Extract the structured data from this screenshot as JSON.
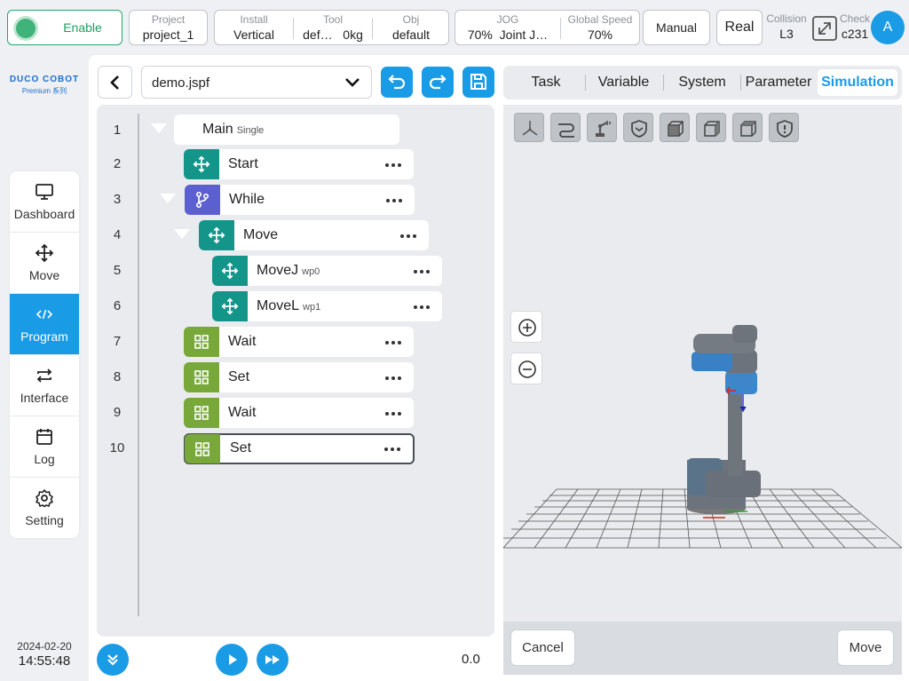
{
  "status": {
    "enable_label": "Enable",
    "project": {
      "caption": "Project",
      "value": "project_1"
    },
    "install": {
      "caption": "Install",
      "value": "Vertical"
    },
    "tool": {
      "caption": "Tool",
      "name": "def…",
      "weight": "0kg"
    },
    "obj": {
      "caption": "Obj",
      "value": "default"
    },
    "jog": {
      "caption": "JOG",
      "value": "70%",
      "mode": "Joint J…"
    },
    "global_speed": {
      "caption": "Global Speed",
      "value": "70%"
    },
    "mode": "Manual",
    "run_mode": "Real",
    "collision": {
      "caption": "Collision",
      "value": "L3"
    },
    "check": {
      "caption": "Check",
      "value": "c231"
    },
    "avatar": "A"
  },
  "brand": {
    "name": "DUCO COBOT",
    "series": "Premium 系列"
  },
  "nav": [
    {
      "id": "dashboard",
      "label": "Dashboard",
      "icon": "monitor-icon",
      "active": false
    },
    {
      "id": "move",
      "label": "Move",
      "icon": "move-arrows-icon",
      "active": false
    },
    {
      "id": "program",
      "label": "Program",
      "icon": "code-icon",
      "active": true
    },
    {
      "id": "interface",
      "label": "Interface",
      "icon": "swap-icon",
      "active": false
    },
    {
      "id": "log",
      "label": "Log",
      "icon": "calendar-icon",
      "active": false
    },
    {
      "id": "setting",
      "label": "Setting",
      "icon": "gear-icon",
      "active": false
    }
  ],
  "datetime": {
    "date": "2024-02-20",
    "time": "14:55:48"
  },
  "program": {
    "file": "demo.jspf",
    "nodes": [
      {
        "line": "1",
        "title": "Main",
        "sub": "Single",
        "type": "main"
      },
      {
        "line": "2",
        "title": "Start",
        "sub": "",
        "type": "move"
      },
      {
        "line": "3",
        "title": "While",
        "sub": "",
        "type": "while"
      },
      {
        "line": "4",
        "title": "Move",
        "sub": "",
        "type": "move"
      },
      {
        "line": "5",
        "title": "MoveJ",
        "sub": "wp0",
        "type": "move"
      },
      {
        "line": "6",
        "title": "MoveL",
        "sub": "wp1",
        "type": "move"
      },
      {
        "line": "7",
        "title": "Wait",
        "sub": "",
        "type": "logic"
      },
      {
        "line": "8",
        "title": "Set",
        "sub": "",
        "type": "logic"
      },
      {
        "line": "9",
        "title": "Wait",
        "sub": "",
        "type": "logic"
      },
      {
        "line": "10",
        "title": "Set",
        "sub": "",
        "type": "logic",
        "selected": true
      }
    ],
    "speed_readout": "0.0"
  },
  "tabs": [
    {
      "label": "Task",
      "active": false
    },
    {
      "label": "Variable",
      "active": false
    },
    {
      "label": "System",
      "active": false
    },
    {
      "label": "Parameter",
      "active": false
    },
    {
      "label": "Simulation",
      "active": true
    }
  ],
  "simulation": {
    "view_buttons": [
      "axes-view-icon",
      "path-icon",
      "robot-view-icon",
      "shield-icon",
      "cube-front-icon",
      "cube-side-icon",
      "cube-top-icon",
      "alert-shield-icon"
    ],
    "cancel_label": "Cancel",
    "move_label": "Move"
  },
  "colors": {
    "accent": "#1a9be6",
    "teal": "#13958a",
    "purple": "#5b5fd0",
    "green": "#79a83a"
  }
}
